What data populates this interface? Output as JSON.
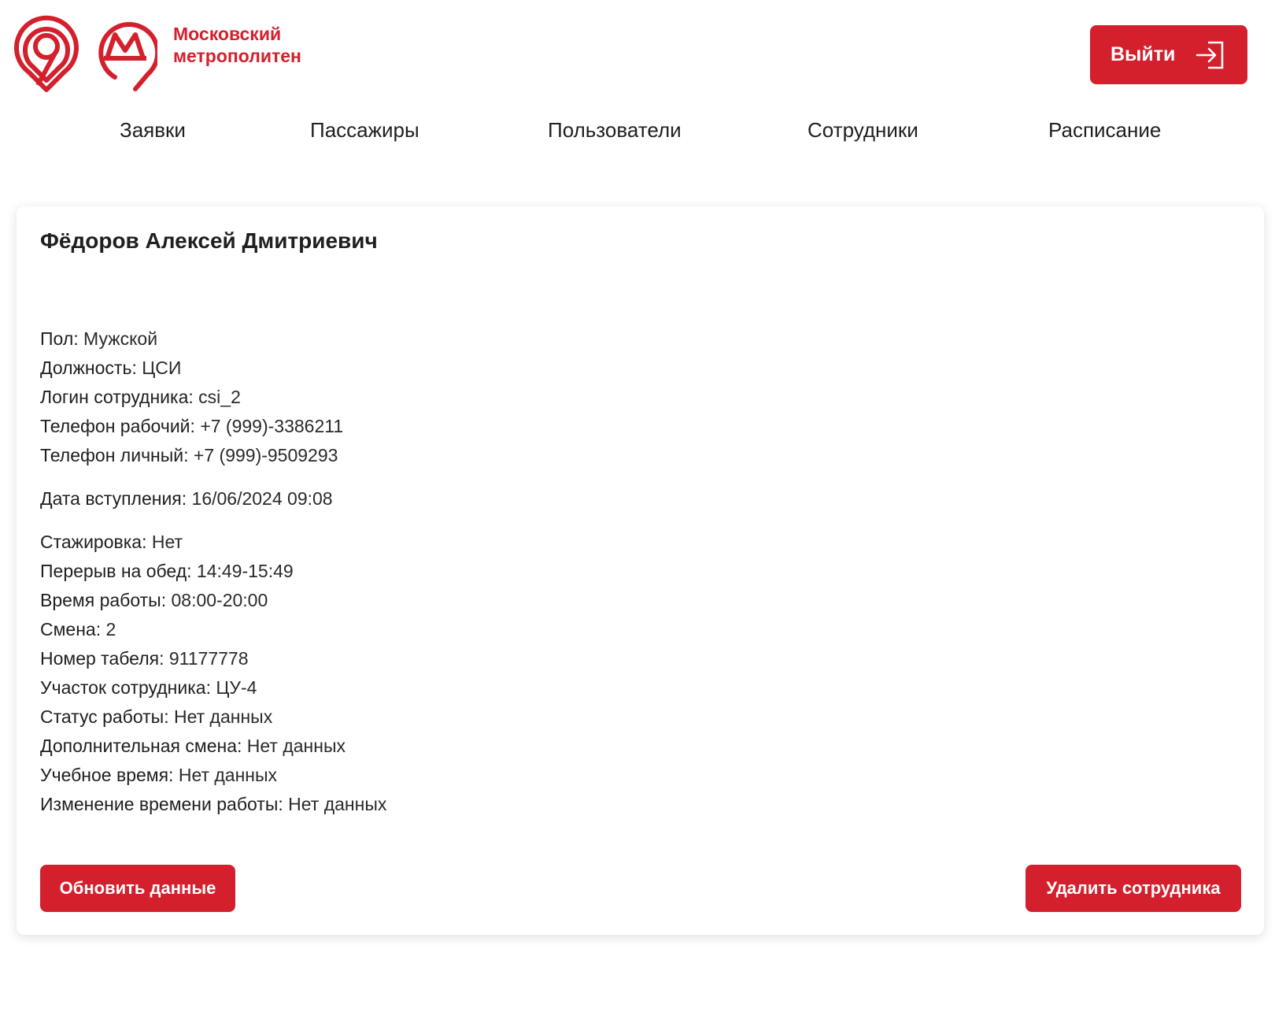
{
  "brand": {
    "line1": "Московский",
    "line2": "метрополитен",
    "color": "#d4202d"
  },
  "header": {
    "logout_label": "Выйти"
  },
  "nav": {
    "items": [
      {
        "label": "Заявки"
      },
      {
        "label": "Пассажиры"
      },
      {
        "label": "Пользователи"
      },
      {
        "label": "Сотрудники"
      },
      {
        "label": "Расписание"
      }
    ]
  },
  "employee": {
    "full_name": "Фёдоров Алексей Дмитриевич",
    "fields": [
      {
        "key": "Пол:",
        "value": "Мужской"
      },
      {
        "key": "Должность:",
        "value": "ЦСИ"
      },
      {
        "key": "Логин сотрудника:",
        "value": "csi_2"
      },
      {
        "key": "Телефон рабочий:",
        "value": "+7 (999)-3386211"
      },
      {
        "key": "Телефон личный:",
        "value": "+7 (999)-9509293"
      },
      {
        "key": "Дата вступления:",
        "value": "16/06/2024 09:08"
      },
      {
        "key": "Стажировка:",
        "value": "Нет"
      },
      {
        "key": "Перерыв на обед:",
        "value": "14:49-15:49"
      },
      {
        "key": "Время работы:",
        "value": "08:00-20:00"
      },
      {
        "key": "Смена:",
        "value": "2"
      },
      {
        "key": "Номер табеля:",
        "value": "91177778"
      },
      {
        "key": "Участок сотрудника:",
        "value": "ЦУ-4"
      },
      {
        "key": "Статус работы:",
        "value": "Нет данных"
      },
      {
        "key": "Дополнительная смена:",
        "value": "Нет данных"
      },
      {
        "key": "Учебное время:",
        "value": "Нет данных"
      },
      {
        "key": "Изменение времени работы:",
        "value": "Нет данных"
      }
    ]
  },
  "actions": {
    "update_label": "Обновить данные",
    "delete_label": "Удалить сотрудника"
  }
}
